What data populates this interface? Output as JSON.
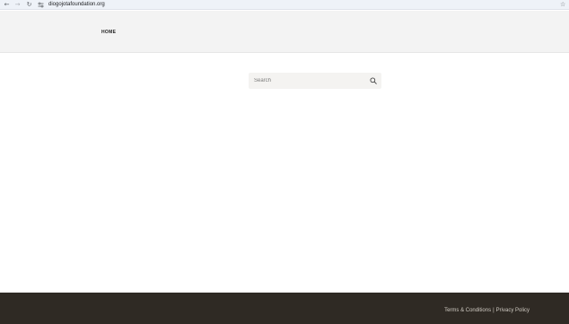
{
  "browser": {
    "back_icon": "arrow-left-icon",
    "forward_icon": "arrow-right-icon",
    "reload_icon": "reload-icon",
    "site_info_icon": "tune-icon",
    "url": "diogojotafoundation.org",
    "bookmark_icon": "star-icon"
  },
  "header": {
    "nav_home": "HOME"
  },
  "search": {
    "placeholder": "Search",
    "icon": "search-icon"
  },
  "footer": {
    "terms_label": "Terms & Conditions",
    "separator": "|",
    "privacy_label": "Privacy Policy",
    "background": "#2f2a24"
  }
}
